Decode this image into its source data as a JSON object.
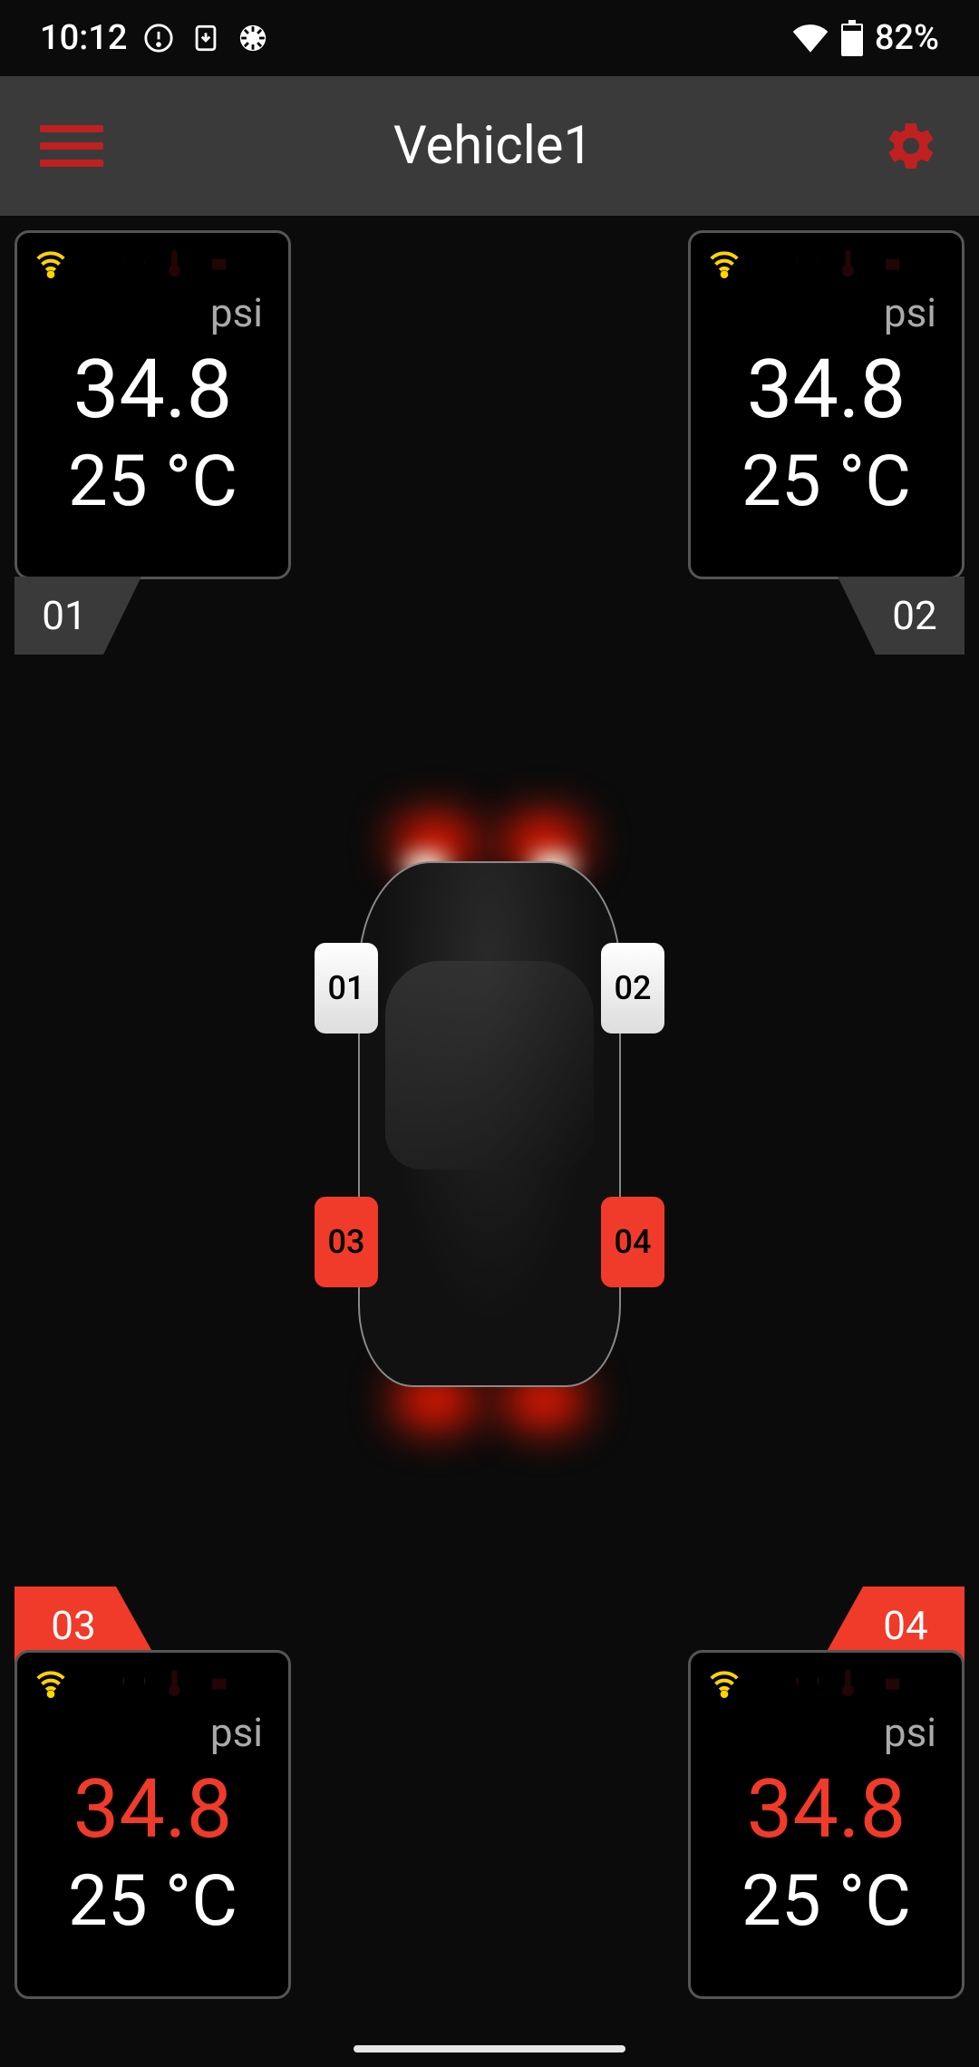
{
  "status": {
    "time": "10:12",
    "battery": "82%"
  },
  "header": {
    "title": "Vehicle1"
  },
  "tires": [
    {
      "id": "01",
      "unit": "psi",
      "pressure": "34.8",
      "temp": "25 °C",
      "alert": false
    },
    {
      "id": "02",
      "unit": "psi",
      "pressure": "34.8",
      "temp": "25 °C",
      "alert": false
    },
    {
      "id": "03",
      "unit": "psi",
      "pressure": "34.8",
      "temp": "25 °C",
      "alert": true
    },
    {
      "id": "04",
      "unit": "psi",
      "pressure": "34.8",
      "temp": "25 °C",
      "alert": true
    }
  ],
  "diagram": {
    "front_left": "01",
    "front_right": "02",
    "rear_left": "03",
    "rear_right": "04"
  }
}
